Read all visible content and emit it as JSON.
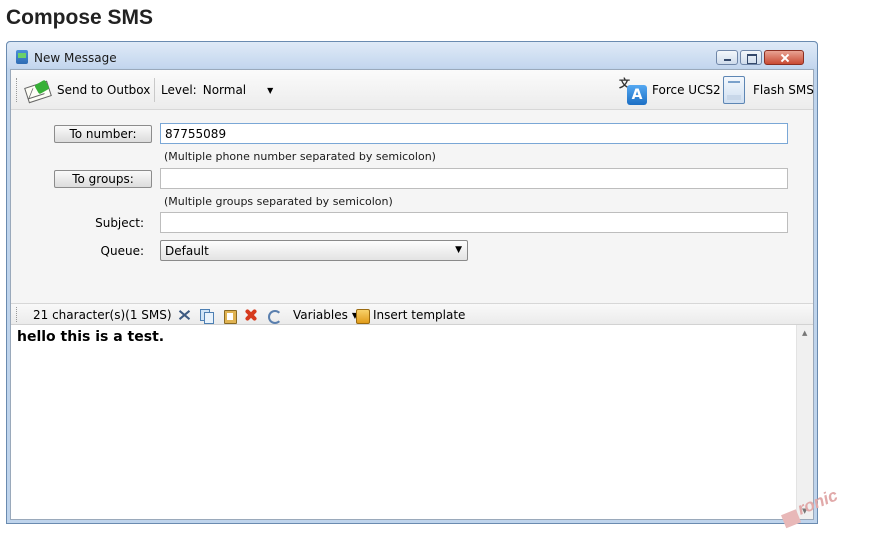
{
  "page": {
    "title": "Compose SMS"
  },
  "window": {
    "title": "New Message"
  },
  "toolbar": {
    "send_label": "Send to Outbox",
    "level_label": "Level:",
    "level_value": "Normal",
    "force_ucs2_label": "Force UCS2",
    "flash_sms_label": "Flash SMS"
  },
  "form": {
    "to_number_button": "To number:",
    "to_number_value": "87755089",
    "to_number_hint": "(Multiple phone number separated by semicolon)",
    "to_groups_button": "To groups:",
    "to_groups_value": "",
    "to_groups_hint": "(Multiple groups separated by semicolon)",
    "subject_label": "Subject:",
    "subject_value": "",
    "queue_label": "Queue:",
    "queue_value": "Default"
  },
  "editor": {
    "char_count": "21 character(s)(1 SMS)",
    "variables_label": "Variables",
    "insert_template_label": "Insert template",
    "message": "hello this is a test."
  },
  "watermark": {
    "text": "ronic"
  }
}
